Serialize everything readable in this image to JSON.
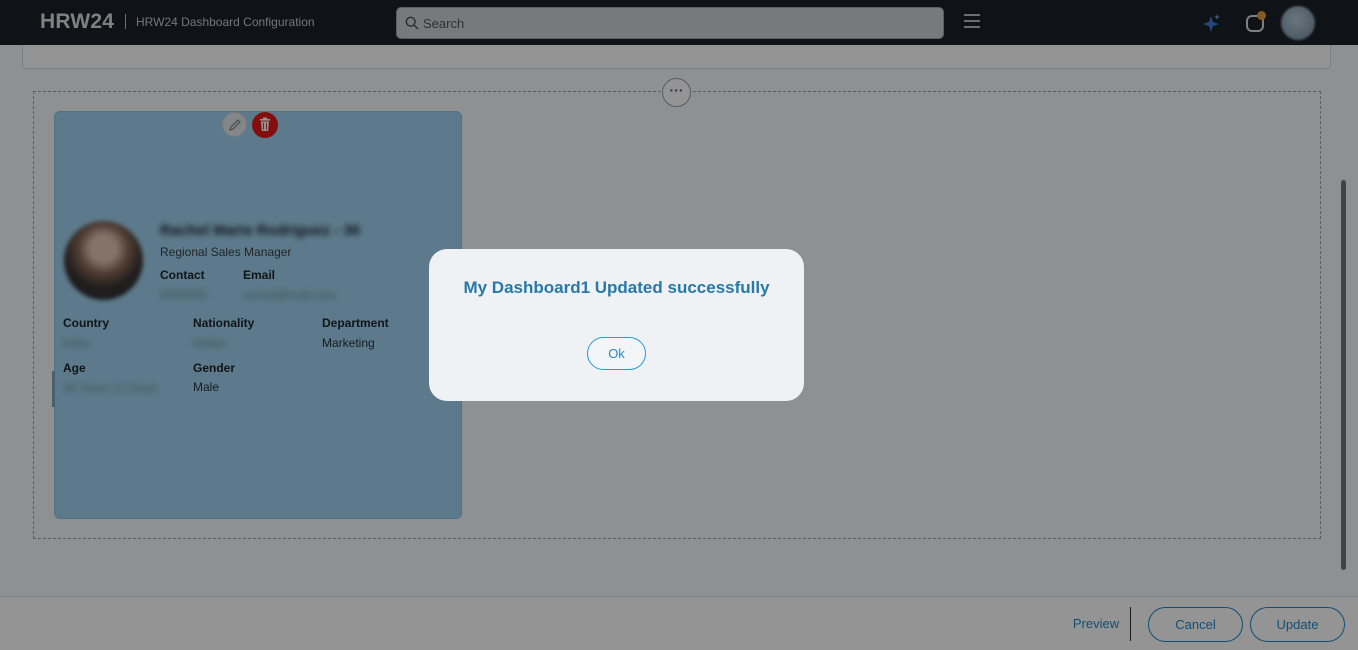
{
  "header": {
    "brand": "HRW24",
    "subtitle": "HRW24 Dashboard Configuration",
    "search_placeholder": "Search",
    "icons": [
      "search-icon",
      "hamburger-menu-icon",
      "sparkle-icon",
      "notification-icon"
    ]
  },
  "card": {
    "employee_name": "Rachel Marie Rodriguez - 36",
    "job_title": "Regional Sales Manager",
    "contact_label": "Contact",
    "contact_value": "0000000",
    "email_label": "Email",
    "email_value": "rachel@mail.com",
    "country_label": "Country",
    "country_value": "India",
    "nationality_label": "Nationality",
    "nationality_value": "Indian",
    "department_label": "Department",
    "department_value": "Marketing",
    "age_label": "Age",
    "age_value": "36 Years 12 Days",
    "gender_label": "Gender",
    "gender_value": "Male"
  },
  "more_button": "···",
  "footer": {
    "preview_label": "Preview",
    "cancel_label": "Cancel",
    "update_label": "Update"
  },
  "dialog": {
    "message": "My Dashboard1 Updated successfully",
    "ok_label": "Ok"
  },
  "colors": {
    "header_bg": "#1b1f27",
    "accent": "#1e88c8",
    "card_bg": "#9fd3ef",
    "delete": "#e01919",
    "dialog_title": "#2779a7"
  }
}
